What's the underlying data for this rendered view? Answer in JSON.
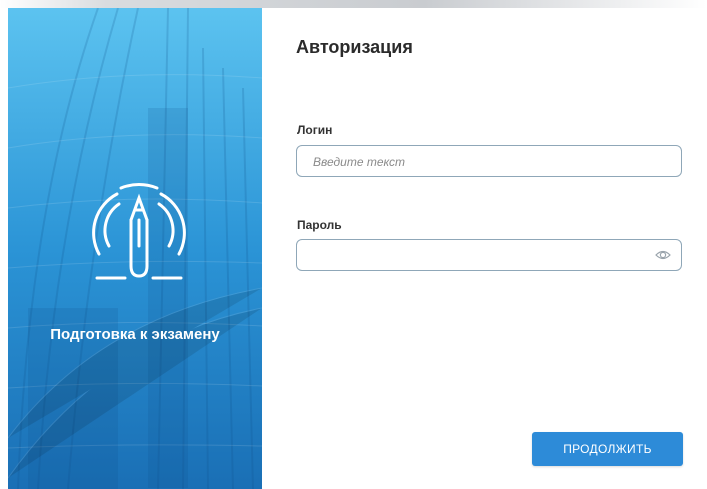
{
  "hero": {
    "title": "Подготовка к экзамену",
    "logo_icon": "pencil-signal-icon",
    "bg_color": "#2a93d6"
  },
  "form": {
    "title": "Авторизация",
    "login": {
      "label": "Логин",
      "placeholder": "Введите текст",
      "value": ""
    },
    "password": {
      "label": "Пароль",
      "value": "",
      "toggle_icon": "eye-icon"
    },
    "submit_label": "ПРОДОЛЖИТЬ",
    "accent_color": "#2d8bd8"
  }
}
